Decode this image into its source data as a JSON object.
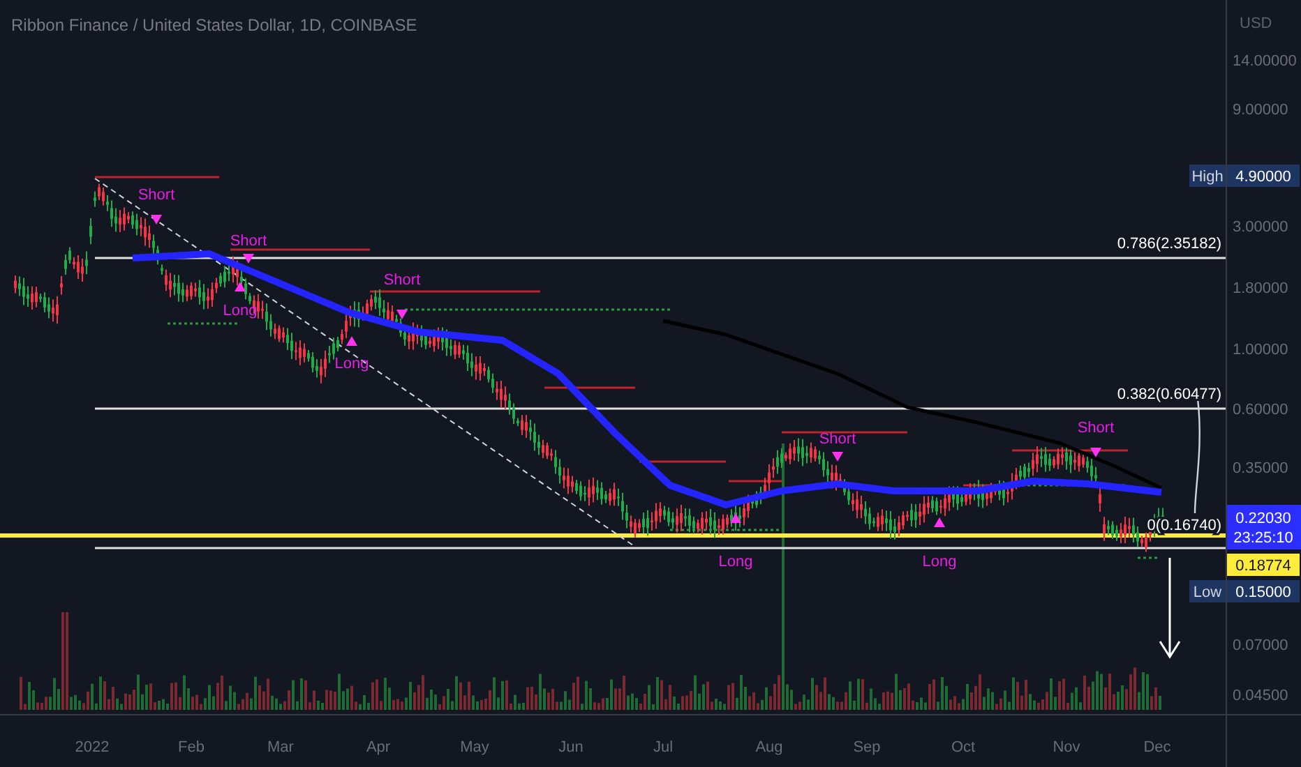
{
  "header": {
    "title": "Ribbon Finance / United States Dollar, 1D, COINBASE"
  },
  "price_axis": {
    "currency": "USD",
    "ticks": [
      "14.00000",
      "9.00000",
      "3.00000",
      "1.80000",
      "1.00000",
      "0.60000",
      "0.35000",
      "0.07000",
      "0.04500"
    ]
  },
  "markers": [
    {
      "kind": "high",
      "label": "High",
      "value": "4.90000"
    },
    {
      "kind": "low",
      "label": "Low",
      "value": "0.15000"
    }
  ],
  "last_price": {
    "value": "0.22030",
    "countdown": "23:25:10"
  },
  "previous_close": {
    "value": "0.18774"
  },
  "time_axis": {
    "ticks": [
      "2022",
      "Feb",
      "Mar",
      "Apr",
      "May",
      "Jun",
      "Jul",
      "Aug",
      "Sep",
      "Oct",
      "Nov",
      "Dec"
    ]
  },
  "fib_levels": [
    {
      "label": "0.786(2.35182)"
    },
    {
      "label": "0.382(0.60477)"
    },
    {
      "label": "0(0.16740)"
    }
  ],
  "signals": [
    {
      "kind": "short",
      "label": "Short"
    },
    {
      "kind": "short",
      "label": "Short"
    },
    {
      "kind": "long",
      "label": "Long"
    },
    {
      "kind": "short",
      "label": "Short"
    },
    {
      "kind": "long",
      "label": "Long"
    },
    {
      "kind": "short",
      "label": "Short"
    },
    {
      "kind": "long",
      "label": "Long"
    },
    {
      "kind": "long",
      "label": "Long"
    },
    {
      "kind": "short",
      "label": "Short"
    }
  ]
}
